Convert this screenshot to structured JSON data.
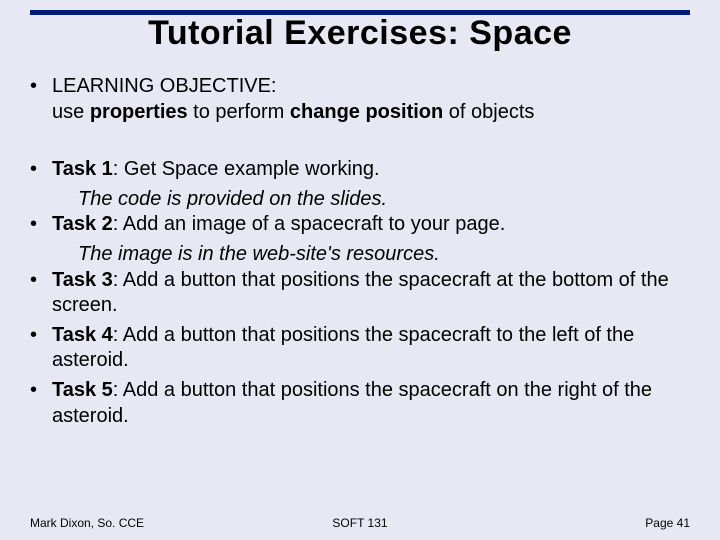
{
  "title": "Tutorial Exercises: Space",
  "lo_label": "LEARNING OBJECTIVE:",
  "lo_line": {
    "pre": "use ",
    "b1": "properties",
    "mid": " to perform ",
    "b2": "change position",
    "post": " of  objects"
  },
  "tasks": [
    {
      "label": "Task 1",
      "text": ": Get Space example working.",
      "sub": "The code is provided on the slides."
    },
    {
      "label": "Task 2",
      "text": ": Add an image of a spacecraft to your page.",
      "sub": "The image is in the web-site's resources."
    },
    {
      "label": "Task 3",
      "text": ": Add a button that positions the spacecraft at the bottom of the screen."
    },
    {
      "label": "Task 4",
      "text": ": Add a button that positions the spacecraft to the left of the asteroid."
    },
    {
      "label": "Task 5",
      "text": ": Add a button that positions the spacecraft on the right of the asteroid."
    }
  ],
  "footer": {
    "left": "Mark Dixon, So. CCE",
    "mid": "SOFT 131",
    "right": "Page 41"
  },
  "dot": "•"
}
